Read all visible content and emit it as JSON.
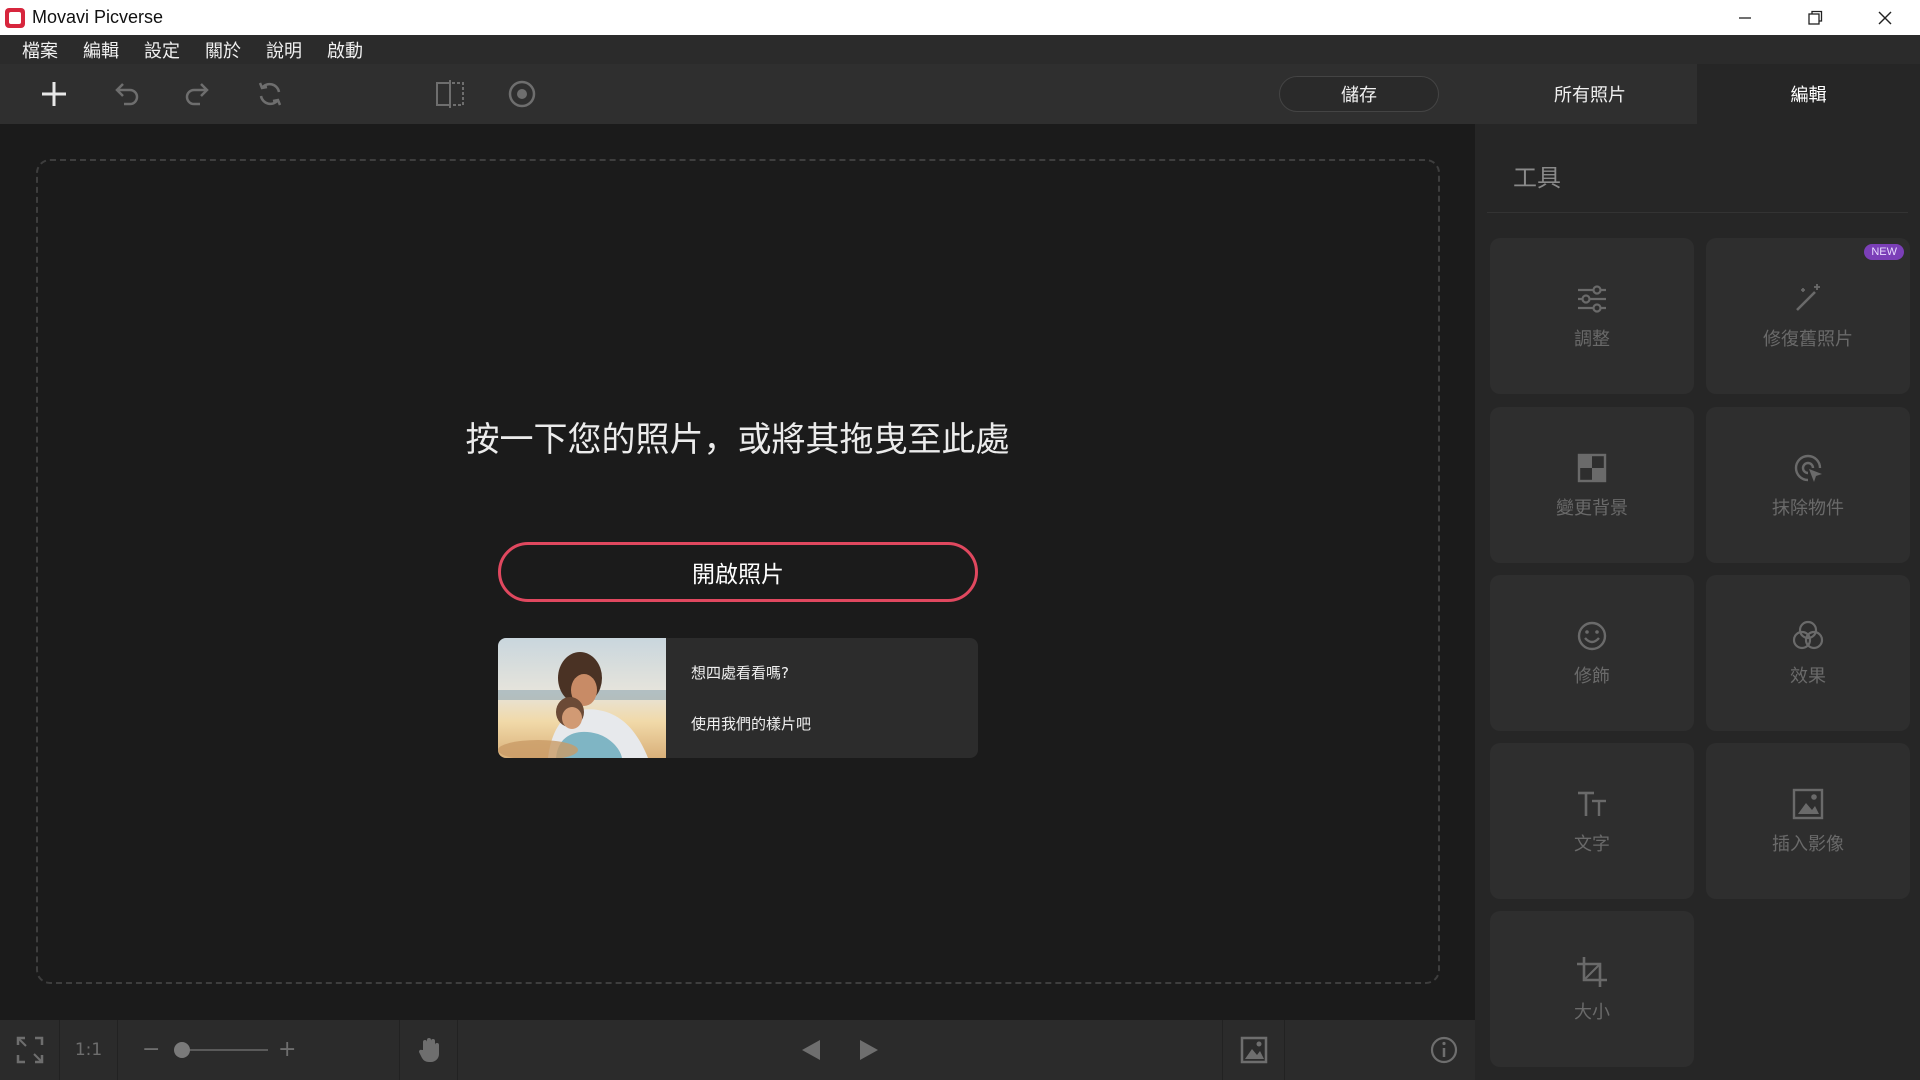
{
  "window": {
    "title": "Movavi Picverse"
  },
  "menu": {
    "items": [
      "檔案",
      "編輯",
      "設定",
      "關於",
      "說明",
      "啟動"
    ]
  },
  "toolbar": {
    "save_label": "儲存",
    "tab_all_photos": "所有照片",
    "tab_edit": "編輯",
    "icons": [
      "plus-icon",
      "undo-icon",
      "redo-icon",
      "refresh-icon",
      "compare-icon",
      "eye-icon"
    ]
  },
  "canvas": {
    "prompt": "按一下您的照片，或將其拖曳至此處",
    "open_button": "開啟照片",
    "sample": {
      "line1": "想四處看看嗎?",
      "line2": "使用我們的樣片吧"
    }
  },
  "bottombar": {
    "zoom_ratio": "1:1",
    "zoom_minus": "−",
    "zoom_plus": "+"
  },
  "panel": {
    "title": "工具",
    "tools": [
      {
        "label": "調整",
        "icon": "sliders-icon"
      },
      {
        "label": "修復舊照片",
        "icon": "magic-wand-icon",
        "badge": "NEW"
      },
      {
        "label": "變更背景",
        "icon": "background-icon"
      },
      {
        "label": "抹除物件",
        "icon": "eraser-target-icon"
      },
      {
        "label": "修飾",
        "icon": "smile-icon"
      },
      {
        "label": "效果",
        "icon": "effects-icon"
      },
      {
        "label": "文字",
        "icon": "text-icon"
      },
      {
        "label": "插入影像",
        "icon": "insert-image-icon"
      },
      {
        "label": "大小",
        "icon": "crop-icon"
      }
    ]
  },
  "colors": {
    "accent": "#e0485f",
    "badge": "#7b3fb8",
    "background": "#1b1b1b",
    "panel": "#262626"
  }
}
